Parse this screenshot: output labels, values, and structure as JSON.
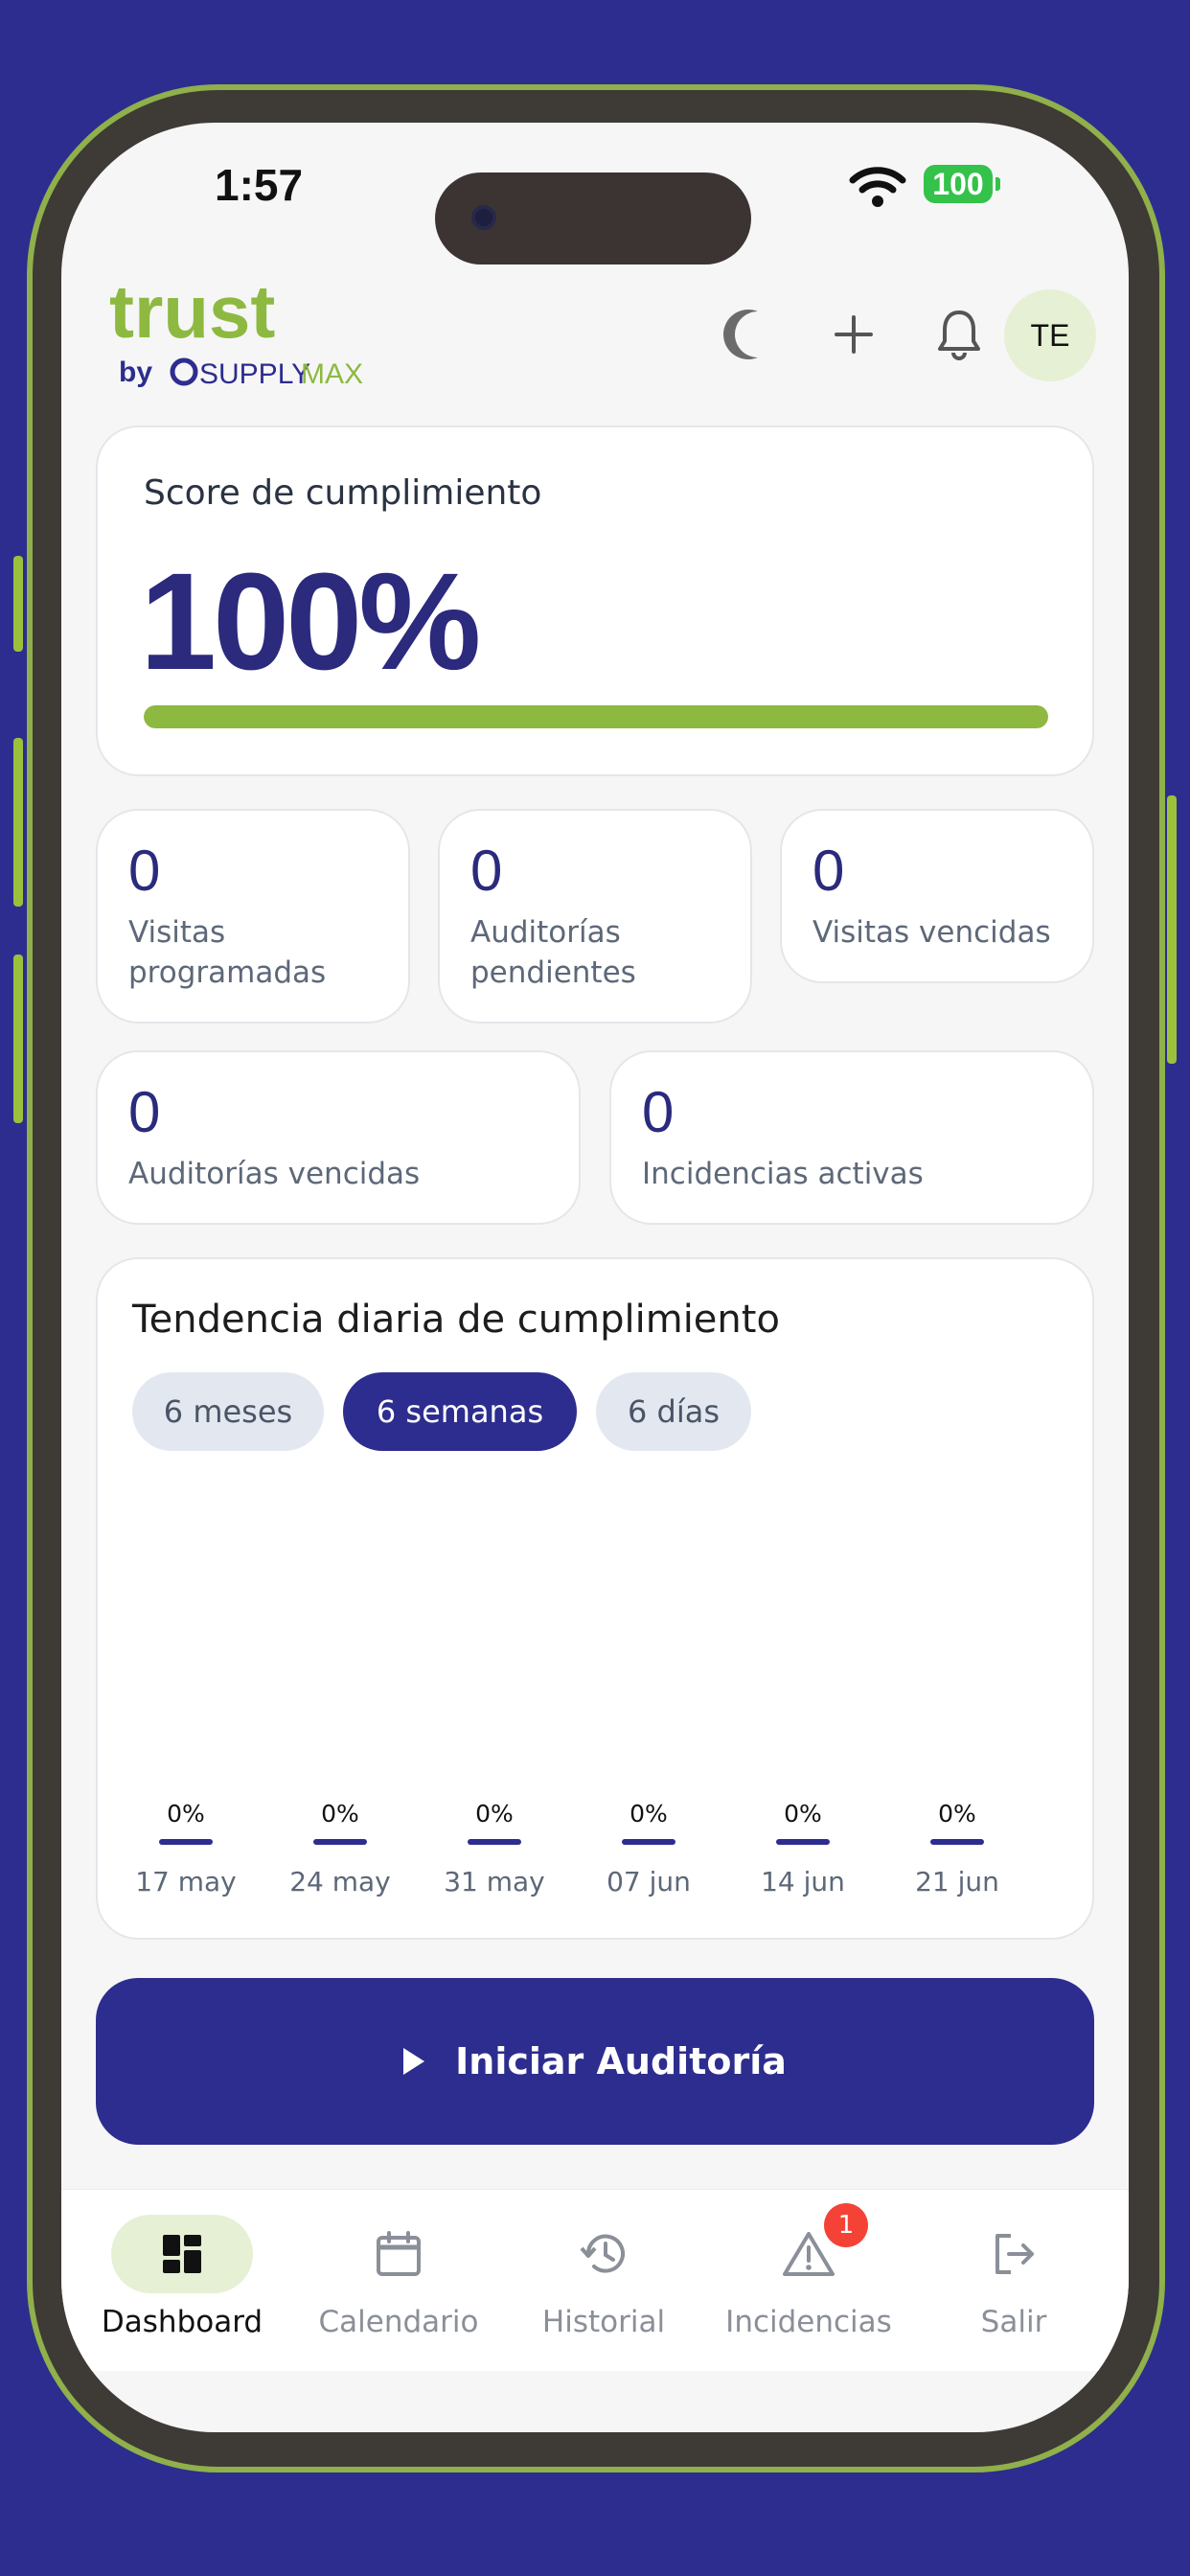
{
  "status_bar": {
    "time": "1:57",
    "battery": "100"
  },
  "brand": {
    "logo_main": "trust",
    "logo_by": "by",
    "logo_supply": "SUPPLY",
    "logo_max": "MAX",
    "colors": {
      "green": "#8db940",
      "navy": "#2d2d8f"
    }
  },
  "header": {
    "theme_icon": "moon-icon",
    "add_icon": "plus-icon",
    "notifications_icon": "bell-icon",
    "avatar_initials": "TE"
  },
  "score": {
    "title": "Score de cumplimiento",
    "value": "100%",
    "progress": 1.0
  },
  "stats": [
    {
      "value": "0",
      "label": "Visitas programadas"
    },
    {
      "value": "0",
      "label": "Auditorías pendientes"
    },
    {
      "value": "0",
      "label": "Visitas vencidas"
    },
    {
      "value": "0",
      "label": "Auditorías vencidas"
    },
    {
      "value": "0",
      "label": "Incidencias activas"
    }
  ],
  "trend": {
    "title": "Tendencia diaria de cumplimiento",
    "ranges": [
      {
        "label": "6 meses",
        "active": false
      },
      {
        "label": "6 semanas",
        "active": true
      },
      {
        "label": "6 días",
        "active": false
      }
    ]
  },
  "chart_data": {
    "type": "bar",
    "title": "Tendencia diaria de cumplimiento",
    "categories": [
      "17 may",
      "24 may",
      "31 may",
      "07 jun",
      "14 jun",
      "21 jun"
    ],
    "values": [
      0,
      0,
      0,
      0,
      0,
      0
    ],
    "data_labels": [
      "0%",
      "0%",
      "0%",
      "0%",
      "0%",
      "0%"
    ],
    "ylim": [
      0,
      100
    ],
    "grid": false
  },
  "cta": {
    "label": "Iniciar Auditoría",
    "icon": "play-icon"
  },
  "tabs": [
    {
      "label": "Dashboard",
      "icon": "dashboard-icon",
      "active": true
    },
    {
      "label": "Calendario",
      "icon": "calendar-icon",
      "active": false
    },
    {
      "label": "Historial",
      "icon": "history-icon",
      "active": false
    },
    {
      "label": "Incidencias",
      "icon": "warning-icon",
      "active": false,
      "badge": "1"
    },
    {
      "label": "Salir",
      "icon": "logout-icon",
      "active": false
    }
  ]
}
